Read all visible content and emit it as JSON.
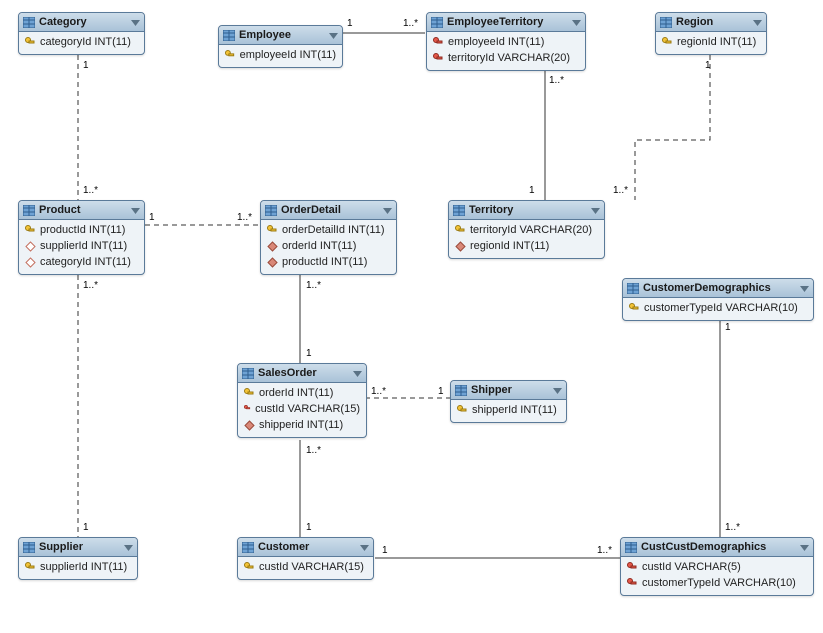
{
  "entities": {
    "category": {
      "title": "Category",
      "cols": [
        {
          "icon": "pk",
          "text": "categoryId INT(11)"
        }
      ]
    },
    "employee": {
      "title": "Employee",
      "cols": [
        {
          "icon": "pk",
          "text": "employeeId INT(11)"
        }
      ]
    },
    "employeeTerritory": {
      "title": "EmployeeTerritory",
      "cols": [
        {
          "icon": "fk-red",
          "text": "employeeId INT(11)"
        },
        {
          "icon": "fk-red",
          "text": "territoryId VARCHAR(20)"
        }
      ]
    },
    "region": {
      "title": "Region",
      "cols": [
        {
          "icon": "pk",
          "text": "regionId INT(11)"
        }
      ]
    },
    "product": {
      "title": "Product",
      "cols": [
        {
          "icon": "pk",
          "text": "productId INT(11)"
        },
        {
          "icon": "nul",
          "text": "supplierId INT(11)"
        },
        {
          "icon": "nul",
          "text": "categoryId INT(11)"
        }
      ]
    },
    "orderDetail": {
      "title": "OrderDetail",
      "cols": [
        {
          "icon": "pk",
          "text": "orderDetailId INT(11)"
        },
        {
          "icon": "fk",
          "text": "orderId INT(11)"
        },
        {
          "icon": "fk",
          "text": "productId INT(11)"
        }
      ]
    },
    "territory": {
      "title": "Territory",
      "cols": [
        {
          "icon": "pk",
          "text": "territoryId VARCHAR(20)"
        },
        {
          "icon": "fk",
          "text": "regionId INT(11)"
        }
      ]
    },
    "customerDemographics": {
      "title": "CustomerDemographics",
      "cols": [
        {
          "icon": "pk",
          "text": "customerTypeId VARCHAR(10)"
        }
      ]
    },
    "salesOrder": {
      "title": "SalesOrder",
      "cols": [
        {
          "icon": "pk",
          "text": "orderId INT(11)"
        },
        {
          "icon": "fk-red",
          "text": "custId VARCHAR(15)"
        },
        {
          "icon": "fk",
          "text": "shipperid INT(11)"
        }
      ]
    },
    "shipper": {
      "title": "Shipper",
      "cols": [
        {
          "icon": "pk",
          "text": "shipperId INT(11)"
        }
      ]
    },
    "supplier": {
      "title": "Supplier",
      "cols": [
        {
          "icon": "pk",
          "text": "supplierId INT(11)"
        }
      ]
    },
    "customer": {
      "title": "Customer",
      "cols": [
        {
          "icon": "pk",
          "text": "custId VARCHAR(15)"
        }
      ]
    },
    "custCustDemographics": {
      "title": "CustCustDemographics",
      "cols": [
        {
          "icon": "fk-red",
          "text": "custId VARCHAR(5)"
        },
        {
          "icon": "fk-red",
          "text": "customerTypeId VARCHAR(10)"
        }
      ]
    }
  },
  "cardinalities": {
    "c1": "1",
    "c2": "1..*",
    "c3": "1",
    "c4": "1..*",
    "c5": "1",
    "c6": "1..*",
    "c7": "1..*",
    "c8": "1",
    "c9": "1",
    "c10": "1..*",
    "c11": "1",
    "c12": "1..*",
    "c13": "1..*",
    "c14": "1",
    "c15": "1..*",
    "c16": "1",
    "c17": "1",
    "c18": "1..*",
    "c19": "1",
    "c20": "1..*",
    "c21": "1",
    "c22": "1..*"
  }
}
